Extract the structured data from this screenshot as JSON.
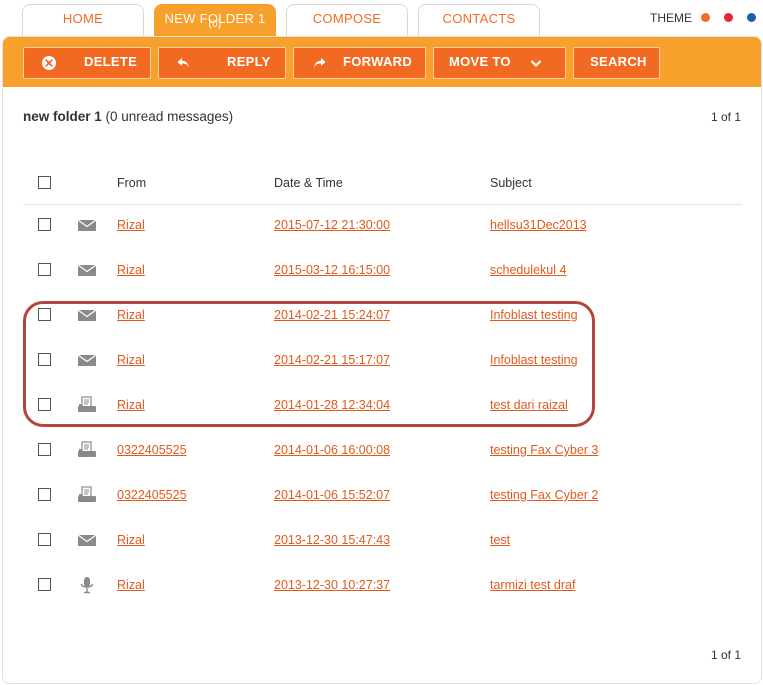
{
  "tabs": [
    {
      "label": "HOME",
      "active": false
    },
    {
      "label": "NEW FOLDER 1",
      "count": "(0)",
      "active": true
    },
    {
      "label": "COMPOSE",
      "active": false
    },
    {
      "label": "CONTACTS",
      "active": false
    }
  ],
  "theme": {
    "label": "THEME",
    "colors": [
      "#f26a22",
      "#e5243c",
      "#1e5fb4"
    ]
  },
  "toolbar": {
    "delete_label": "DELETE",
    "delete_icon": "close-circle-icon",
    "reply_label": "REPLY",
    "reply_icon": "reply-arrow-icon",
    "forward_label": "FORWARD",
    "forward_icon": "forward-arrow-icon",
    "move_to_label": "MOVE TO",
    "move_to_icon": "chevron-down-icon",
    "search_label": "SEARCH"
  },
  "folder": {
    "name": "new folder 1",
    "unread": "(0 unread messages)",
    "page_top": "1 of 1",
    "page_bottom": "1 of 1"
  },
  "table": {
    "columns": {
      "from": "From",
      "datetime": "Date & Time",
      "subject": "Subject"
    },
    "rows": [
      {
        "type": "mail",
        "from": "Rizal",
        "datetime": "2015-07-12 21:30:00",
        "subject": "hellsu31Dec2013"
      },
      {
        "type": "mail",
        "from": "Rizal",
        "datetime": "2015-03-12 16:15:00",
        "subject": "schedulekul 4"
      },
      {
        "type": "mail",
        "from": "Rizal",
        "datetime": "2014-02-21 15:24:07",
        "subject": "Infoblast testing"
      },
      {
        "type": "mail",
        "from": "Rizal",
        "datetime": "2014-02-21 15:17:07",
        "subject": "Infoblast testing"
      },
      {
        "type": "fax",
        "from": "Rizal",
        "datetime": "2014-01-28 12:34:04",
        "subject": "test dari raizal"
      },
      {
        "type": "fax",
        "from": "0322405525",
        "datetime": "2014-01-06 16:00:08",
        "subject": "testing Fax Cyber 3"
      },
      {
        "type": "fax",
        "from": "0322405525",
        "datetime": "2014-01-06 15:52:07",
        "subject": "testing Fax Cyber 2"
      },
      {
        "type": "mail",
        "from": "Rizal",
        "datetime": "2013-12-30 15:47:43",
        "subject": "test"
      },
      {
        "type": "voice",
        "from": "Rizal",
        "datetime": "2013-12-30 10:27:37",
        "subject": "tarmizi test draf"
      }
    ]
  },
  "colors": {
    "accent": "#f7a12c",
    "button": "#f26a22",
    "link": "#e05a1e",
    "highlight_ring": "#b4463e"
  }
}
